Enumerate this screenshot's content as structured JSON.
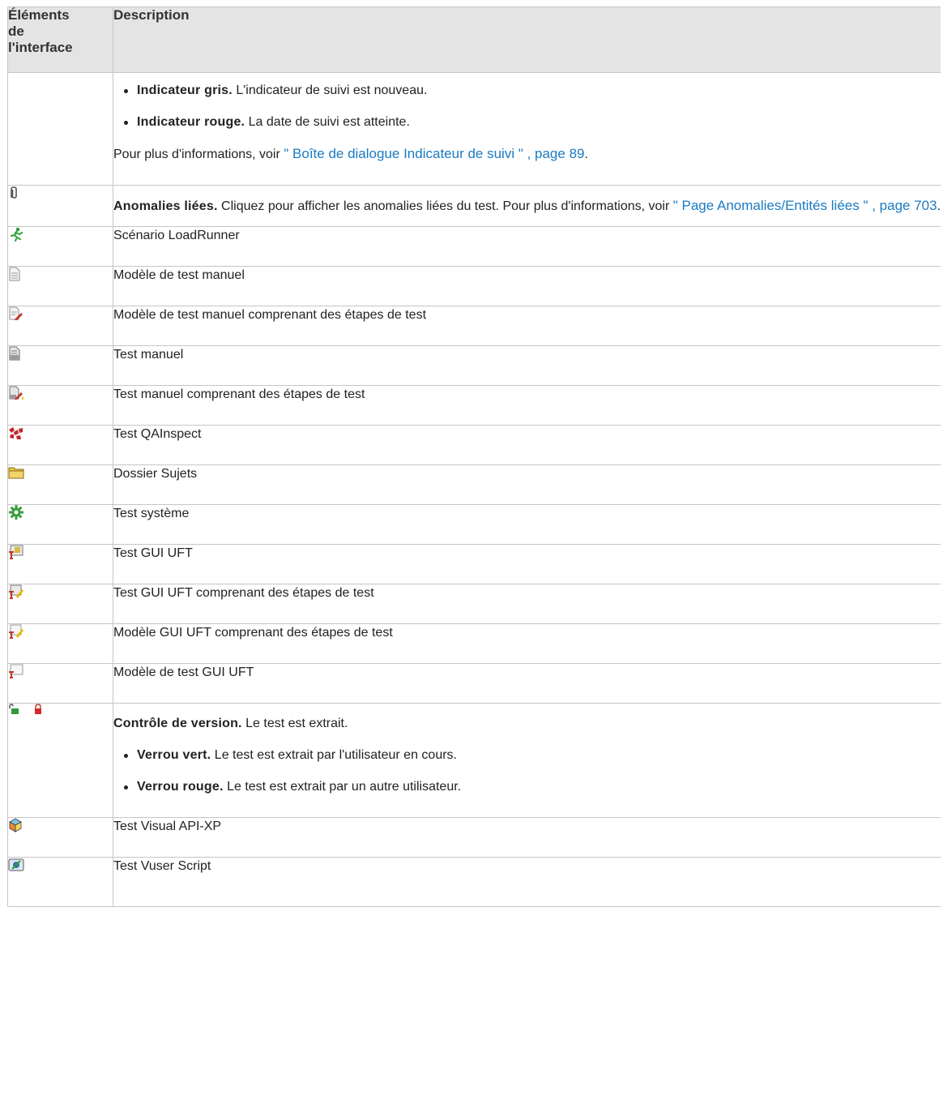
{
  "header": {
    "col1": [
      "Éléments",
      "de",
      "l'interface"
    ],
    "col2": "Description"
  },
  "rows": {
    "flag": {
      "items": [
        {
          "bold": "Indicateur gris.",
          "text": " L'indicateur de suivi est nouveau."
        },
        {
          "bold": "Indicateur rouge.",
          "text": " La date de suivi est atteinte."
        }
      ],
      "more_prefix": "Pour plus d'informations, voir ",
      "more_link": "\" Boîte de dialogue Indicateur de suivi \" , page 89",
      "more_suffix": "."
    },
    "linked": {
      "icon": "paperclip-icon",
      "bold": "Anomalies liées.",
      "text": " Cliquez pour afficher les anomalies liées du test. Pour plus d'informations, voir ",
      "link": "\" Page Anomalies/Entités liées \" , page 703",
      "suffix": "."
    },
    "loadrunner": {
      "icon": "loadrunner-icon",
      "text": "Scénario LoadRunner"
    },
    "manual_template": {
      "icon": "manual-test-template-icon",
      "text": "Modèle de test manuel"
    },
    "manual_template_steps": {
      "icon": "manual-test-template-steps-icon",
      "text": "Modèle de test manuel comprenant des étapes de test"
    },
    "manual": {
      "icon": "manual-test-icon",
      "text": "Test manuel"
    },
    "manual_steps": {
      "icon": "manual-test-steps-icon",
      "text": "Test manuel comprenant des étapes de test"
    },
    "qainspect": {
      "icon": "qainspect-icon",
      "text": "Test QAInspect"
    },
    "folder": {
      "icon": "folder-icon",
      "text": "Dossier Sujets"
    },
    "system": {
      "icon": "system-test-gear-icon",
      "text": "Test système"
    },
    "gui": {
      "icon": "uft-gui-test-icon",
      "text": "Test GUI UFT"
    },
    "gui_steps": {
      "icon": "uft-gui-test-steps-icon",
      "text": "Test GUI UFT comprenant des étapes de test"
    },
    "gui_template_steps": {
      "icon": "uft-gui-template-steps-icon",
      "text": "Modèle GUI UFT comprenant des étapes de test"
    },
    "gui_template": {
      "icon": "uft-gui-template-icon",
      "text": "Modèle de test GUI UFT"
    },
    "version": {
      "icons": [
        "green-lock-icon",
        "red-lock-icon"
      ],
      "bold": "Contrôle de version.",
      "text": " Le test est extrait.",
      "items": [
        {
          "bold": "Verrou vert.",
          "text": " Le test est extrait par l'utilisateur en cours."
        },
        {
          "bold": "Verrou rouge.",
          "text": " Le test est extrait par un autre utilisateur."
        }
      ]
    },
    "visual_api": {
      "icon": "visual-api-cube-icon",
      "text": "Test Visual API-XP"
    },
    "vuser": {
      "icon": "vuser-script-icon",
      "text": "Test Vuser Script"
    }
  },
  "colors": {
    "header_bg": "#e4e4e4",
    "border": "#c6c6c6",
    "link": "#1a7bc2"
  }
}
